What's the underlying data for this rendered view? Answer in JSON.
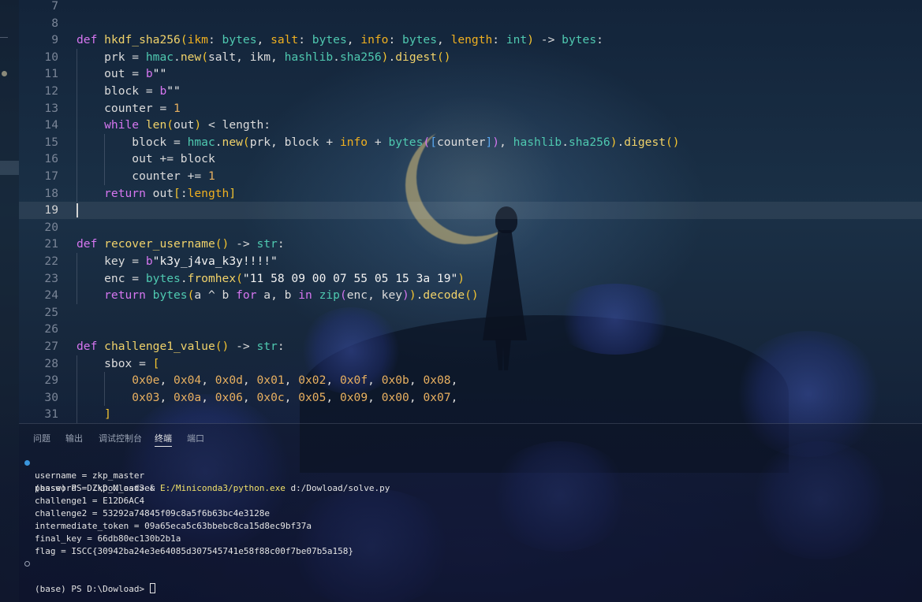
{
  "editor": {
    "current_line": 19,
    "lines": [
      {
        "n": "7",
        "t": []
      },
      {
        "n": "8",
        "t": []
      },
      {
        "n": "9",
        "t": [
          [
            "kw",
            "def "
          ],
          [
            "fn",
            "hkdf_sha256"
          ],
          [
            "br1",
            "("
          ],
          [
            "pa",
            "ikm"
          ],
          [
            "op",
            ": "
          ],
          [
            "ty",
            "bytes"
          ],
          [
            "op",
            ", "
          ],
          [
            "pa",
            "salt"
          ],
          [
            "op",
            ": "
          ],
          [
            "ty",
            "bytes"
          ],
          [
            "op",
            ", "
          ],
          [
            "pa",
            "info"
          ],
          [
            "op",
            ": "
          ],
          [
            "ty",
            "bytes"
          ],
          [
            "op",
            ", "
          ],
          [
            "pa",
            "length"
          ],
          [
            "op",
            ": "
          ],
          [
            "ty",
            "int"
          ],
          [
            "br1",
            ")"
          ],
          [
            "op",
            " -> "
          ],
          [
            "ty",
            "bytes"
          ],
          [
            "op",
            ":"
          ]
        ]
      },
      {
        "n": "10",
        "t": [
          [
            "vr",
            "    prk "
          ],
          [
            "op",
            "= "
          ],
          [
            "ty",
            "hmac"
          ],
          [
            "op",
            "."
          ],
          [
            "fn",
            "new"
          ],
          [
            "br1",
            "("
          ],
          [
            "vr",
            "salt, ikm, "
          ],
          [
            "ty",
            "hashlib"
          ],
          [
            "op",
            "."
          ],
          [
            "ty",
            "sha256"
          ],
          [
            "br1",
            ")"
          ],
          [
            "op",
            "."
          ],
          [
            "fn",
            "digest"
          ],
          [
            "br1",
            "()"
          ]
        ]
      },
      {
        "n": "11",
        "t": [
          [
            "vr",
            "    out "
          ],
          [
            "op",
            "= "
          ],
          [
            "kw",
            "b"
          ],
          [
            "st",
            "\"\""
          ]
        ]
      },
      {
        "n": "12",
        "t": [
          [
            "vr",
            "    block "
          ],
          [
            "op",
            "= "
          ],
          [
            "kw",
            "b"
          ],
          [
            "st",
            "\"\""
          ]
        ]
      },
      {
        "n": "13",
        "t": [
          [
            "vr",
            "    counter "
          ],
          [
            "op",
            "= "
          ],
          [
            "nm",
            "1"
          ]
        ]
      },
      {
        "n": "14",
        "t": [
          [
            "kw",
            "    while "
          ],
          [
            "fn",
            "len"
          ],
          [
            "br1",
            "("
          ],
          [
            "vr",
            "out"
          ],
          [
            "br1",
            ")"
          ],
          [
            "op",
            " < "
          ],
          [
            "vr",
            "length"
          ],
          [
            "op",
            ":"
          ]
        ]
      },
      {
        "n": "15",
        "t": [
          [
            "vr",
            "        block "
          ],
          [
            "op",
            "= "
          ],
          [
            "ty",
            "hmac"
          ],
          [
            "op",
            "."
          ],
          [
            "fn",
            "new"
          ],
          [
            "br1",
            "("
          ],
          [
            "vr",
            "prk, block "
          ],
          [
            "op",
            "+ "
          ],
          [
            "pa",
            "info "
          ],
          [
            "op",
            "+ "
          ],
          [
            "ty",
            "bytes"
          ],
          [
            "br2",
            "("
          ],
          [
            "br3",
            "["
          ],
          [
            "vr",
            "counter"
          ],
          [
            "br3",
            "]"
          ],
          [
            "br2",
            ")"
          ],
          [
            "vr",
            ", "
          ],
          [
            "ty",
            "hashlib"
          ],
          [
            "op",
            "."
          ],
          [
            "ty",
            "sha256"
          ],
          [
            "br1",
            ")"
          ],
          [
            "op",
            "."
          ],
          [
            "fn",
            "digest"
          ],
          [
            "br1",
            "()"
          ]
        ]
      },
      {
        "n": "16",
        "t": [
          [
            "vr",
            "        out "
          ],
          [
            "op",
            "+= "
          ],
          [
            "vr",
            "block"
          ]
        ]
      },
      {
        "n": "17",
        "t": [
          [
            "vr",
            "        counter "
          ],
          [
            "op",
            "+= "
          ],
          [
            "nm",
            "1"
          ]
        ]
      },
      {
        "n": "18",
        "t": [
          [
            "kw",
            "    return "
          ],
          [
            "vr",
            "out"
          ],
          [
            "br1",
            "["
          ],
          [
            "op",
            ":"
          ],
          [
            "pa",
            "length"
          ],
          [
            "br1",
            "]"
          ]
        ]
      },
      {
        "n": "19",
        "t": []
      },
      {
        "n": "20",
        "t": []
      },
      {
        "n": "21",
        "t": [
          [
            "kw",
            "def "
          ],
          [
            "fn",
            "recover_username"
          ],
          [
            "br1",
            "()"
          ],
          [
            "op",
            " -> "
          ],
          [
            "ty",
            "str"
          ],
          [
            "op",
            ":"
          ]
        ]
      },
      {
        "n": "22",
        "t": [
          [
            "vr",
            "    key "
          ],
          [
            "op",
            "= "
          ],
          [
            "kw",
            "b"
          ],
          [
            "st",
            "\"k3y_j4va_k3y!!!!\""
          ]
        ]
      },
      {
        "n": "23",
        "t": [
          [
            "vr",
            "    enc "
          ],
          [
            "op",
            "= "
          ],
          [
            "ty",
            "bytes"
          ],
          [
            "op",
            "."
          ],
          [
            "fn",
            "fromhex"
          ],
          [
            "br1",
            "("
          ],
          [
            "st",
            "\"11 58 09 00 07 55 05 15 3a 19\""
          ],
          [
            "br1",
            ")"
          ]
        ]
      },
      {
        "n": "24",
        "t": [
          [
            "kw",
            "    return "
          ],
          [
            "ty",
            "bytes"
          ],
          [
            "br1",
            "("
          ],
          [
            "vr",
            "a "
          ],
          [
            "op",
            "^ "
          ],
          [
            "vr",
            "b "
          ],
          [
            "kw",
            "for "
          ],
          [
            "vr",
            "a, b "
          ],
          [
            "kw",
            "in "
          ],
          [
            "ty",
            "zip"
          ],
          [
            "br2",
            "("
          ],
          [
            "vr",
            "enc, key"
          ],
          [
            "br2",
            ")"
          ],
          [
            "br1",
            ")"
          ],
          [
            "op",
            "."
          ],
          [
            "fn",
            "decode"
          ],
          [
            "br1",
            "()"
          ]
        ]
      },
      {
        "n": "25",
        "t": []
      },
      {
        "n": "26",
        "t": []
      },
      {
        "n": "27",
        "t": [
          [
            "kw",
            "def "
          ],
          [
            "fn",
            "challenge1_value"
          ],
          [
            "br1",
            "()"
          ],
          [
            "op",
            " -> "
          ],
          [
            "ty",
            "str"
          ],
          [
            "op",
            ":"
          ]
        ]
      },
      {
        "n": "28",
        "t": [
          [
            "vr",
            "    sbox "
          ],
          [
            "op",
            "= "
          ],
          [
            "br1",
            "["
          ]
        ]
      },
      {
        "n": "29",
        "t": [
          [
            "vr",
            "        "
          ],
          [
            "nm",
            "0x0e"
          ],
          [
            "vr",
            ", "
          ],
          [
            "nm",
            "0x04"
          ],
          [
            "vr",
            ", "
          ],
          [
            "nm",
            "0x0d"
          ],
          [
            "vr",
            ", "
          ],
          [
            "nm",
            "0x01"
          ],
          [
            "vr",
            ", "
          ],
          [
            "nm",
            "0x02"
          ],
          [
            "vr",
            ", "
          ],
          [
            "nm",
            "0x0f"
          ],
          [
            "vr",
            ", "
          ],
          [
            "nm",
            "0x0b"
          ],
          [
            "vr",
            ", "
          ],
          [
            "nm",
            "0x08"
          ],
          [
            "vr",
            ","
          ]
        ]
      },
      {
        "n": "30",
        "t": [
          [
            "vr",
            "        "
          ],
          [
            "nm",
            "0x03"
          ],
          [
            "vr",
            ", "
          ],
          [
            "nm",
            "0x0a"
          ],
          [
            "vr",
            ", "
          ],
          [
            "nm",
            "0x06"
          ],
          [
            "vr",
            ", "
          ],
          [
            "nm",
            "0x0c"
          ],
          [
            "vr",
            ", "
          ],
          [
            "nm",
            "0x05"
          ],
          [
            "vr",
            ", "
          ],
          [
            "nm",
            "0x09"
          ],
          [
            "vr",
            ", "
          ],
          [
            "nm",
            "0x00"
          ],
          [
            "vr",
            ", "
          ],
          [
            "nm",
            "0x07"
          ],
          [
            "vr",
            ","
          ]
        ]
      },
      {
        "n": "31",
        "t": [
          [
            "br1",
            "    ]"
          ]
        ]
      }
    ]
  },
  "panel": {
    "tabs": [
      {
        "label": "问题",
        "active": false
      },
      {
        "label": "输出",
        "active": false
      },
      {
        "label": "调试控制台",
        "active": false
      },
      {
        "label": "终端",
        "active": true
      },
      {
        "label": "端口",
        "active": false
      }
    ],
    "terminal": {
      "prompt_cmd": {
        "prompt": "(base) PS D:\\Dowload> ",
        "amp": "& ",
        "exe": "E:/Miniconda3/python.exe",
        "arg": " d:/Dowload/solve.py"
      },
      "output": [
        "username = zkp_master",
        "password = Zkp_M_ast3er",
        "challenge1 = E12D6AC4",
        "challenge2 = 53292a74845f09c8a5f6b63bc4e3128e",
        "intermediate_token = 09a65eca5c63bbebc8ca15d8ec9bf37a",
        "final_key = 66db80ec130b2b1a",
        "flag = ISCC{30942ba24e3e64085d307545741e58f88c00f7be07b5a158}"
      ],
      "final_prompt": "(base) PS D:\\Dowload> "
    }
  }
}
